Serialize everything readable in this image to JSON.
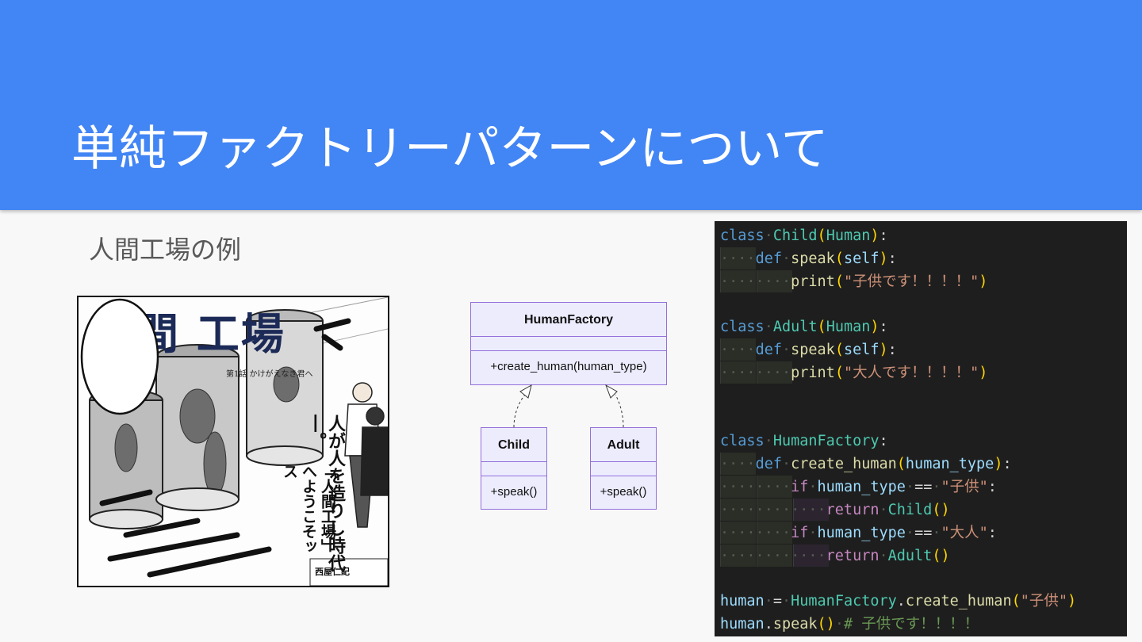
{
  "slide": {
    "title": "単純ファクトリーパターンについて",
    "subtitle": "人間工場の例",
    "colors": {
      "header": "#4285f4",
      "background": "#f8f8f8",
      "code_bg": "#1e1e1e",
      "uml_fill": "#ececfd",
      "uml_stroke": "#9370db"
    }
  },
  "manga": {
    "title": "人間 工場",
    "episode": "第1話 かけがえなき君へ",
    "vertical_text": "人が人を造りし時代―。",
    "balloon_text": "「人間工場」へようこそッス",
    "author": "西屋仁紀"
  },
  "uml": {
    "factory": {
      "name": "HumanFactory",
      "method": "+create_human(human_type)"
    },
    "child": {
      "name": "Child",
      "method": "+speak()"
    },
    "adult": {
      "name": "Adult",
      "method": "+speak()"
    }
  },
  "code": {
    "l1": {
      "kw": "class",
      "cls": "Child",
      "base": "Human"
    },
    "l2": {
      "kw": "def",
      "fn": "speak",
      "arg": "self"
    },
    "l3": {
      "fn": "print",
      "str": "\"子供です！！！！\""
    },
    "l4": {
      "kw": "class",
      "cls": "Adult",
      "base": "Human"
    },
    "l5": {
      "kw": "def",
      "fn": "speak",
      "arg": "self"
    },
    "l6": {
      "fn": "print",
      "str": "\"大人です！！！！\""
    },
    "l7": {
      "kw": "class",
      "cls": "HumanFactory"
    },
    "l8": {
      "kw": "def",
      "fn": "create_human",
      "arg": "human_type"
    },
    "l9": {
      "kw": "if",
      "var": "human_type",
      "op": "==",
      "str": "\"子供\""
    },
    "l10": {
      "kw": "return",
      "cls": "Child"
    },
    "l11": {
      "kw": "if",
      "var": "human_type",
      "op": "==",
      "str": "\"大人\""
    },
    "l12": {
      "kw": "return",
      "cls": "Adult"
    },
    "l13": {
      "var": "human",
      "obj": "HumanFactory",
      "fn": "create_human",
      "str": "\"子供\""
    },
    "l14": {
      "var": "human",
      "fn": "speak",
      "comment": "# 子供です！！！！"
    }
  }
}
